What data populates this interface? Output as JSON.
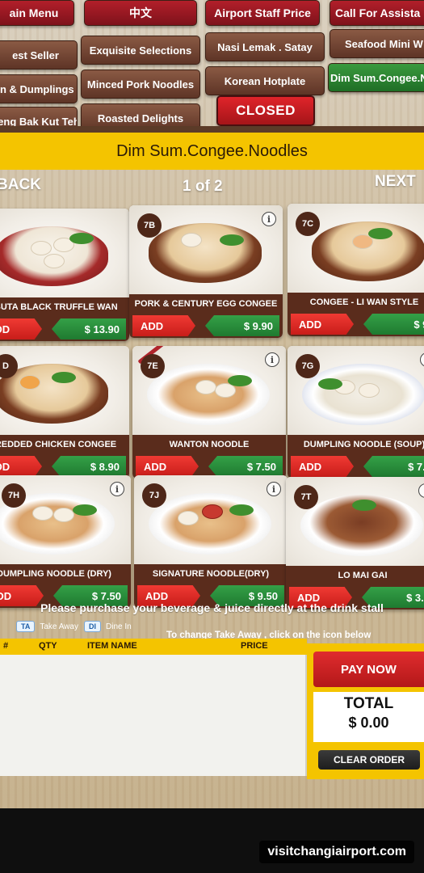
{
  "top_nav": {
    "main_menu": "ain Menu",
    "chinese": "中文",
    "airport_staff_price": "Airport Staff Price",
    "call_for_assistance": "Call For Assista"
  },
  "categories": [
    "est Seller",
    "Exquisite Selections",
    "Nasi Lemak . Satay",
    "Seafood Mini W",
    "in & Dumplings",
    "Minced Pork Noodles",
    "Korean Hotplate",
    "Dim Sum.Congee.N",
    "heng Bak Kut Teh",
    "Roasted Delights",
    "CLOSED"
  ],
  "section_title": "Dim Sum.Congee.Noodles",
  "pager": {
    "back": "BACK",
    "page": "1 of 2",
    "next": "NEXT"
  },
  "add_label": "ADD",
  "info_symbol": "i",
  "items": [
    {
      "code": "",
      "name": "OBUTA BLACK TRUFFLE WAN",
      "price": "$ 13.90"
    },
    {
      "code": "7B",
      "name": "PORK & CENTURY EGG CONGEE",
      "price": "$ 9.90"
    },
    {
      "code": "7C",
      "name": "CONGEE - LI WAN STYLE",
      "price": "$ 9."
    },
    {
      "code": "D",
      "name": "HREDDED CHICKEN CONGEE",
      "price": "$ 8.90"
    },
    {
      "code": "7E",
      "name": "WANTON NOODLE",
      "price": "$ 7.50"
    },
    {
      "code": "7G",
      "name": "DUMPLING NOODLE (SOUP)",
      "price": "$ 7.5"
    },
    {
      "code": "7H",
      "name": "DUMPLING NOODLE (DRY)",
      "price": "$ 7.50"
    },
    {
      "code": "7J",
      "name": "SIGNATURE NOODLE(DRY)",
      "price": "$ 9.50"
    },
    {
      "code": "7T",
      "name": "LO MAI GAI",
      "price": "$ 3.9"
    }
  ],
  "notice": "Please purchase your beverage & juice directly at the drink stall",
  "legend": {
    "ta_badge": "TA",
    "ta_label": "Take Away",
    "di_badge": "DI",
    "di_label": "Dine In"
  },
  "change_note": "To change Take Away , click on the icon below",
  "order_table": {
    "col_num": "#",
    "col_qty": "QTY",
    "col_item": "ITEM NAME",
    "col_price": "PRICE"
  },
  "pay_now": "PAY NOW",
  "total_label": "TOTAL",
  "total_value": "$ 0.00",
  "clear_order": "CLEAR ORDER",
  "watermark": "visitchangiairport.com"
}
